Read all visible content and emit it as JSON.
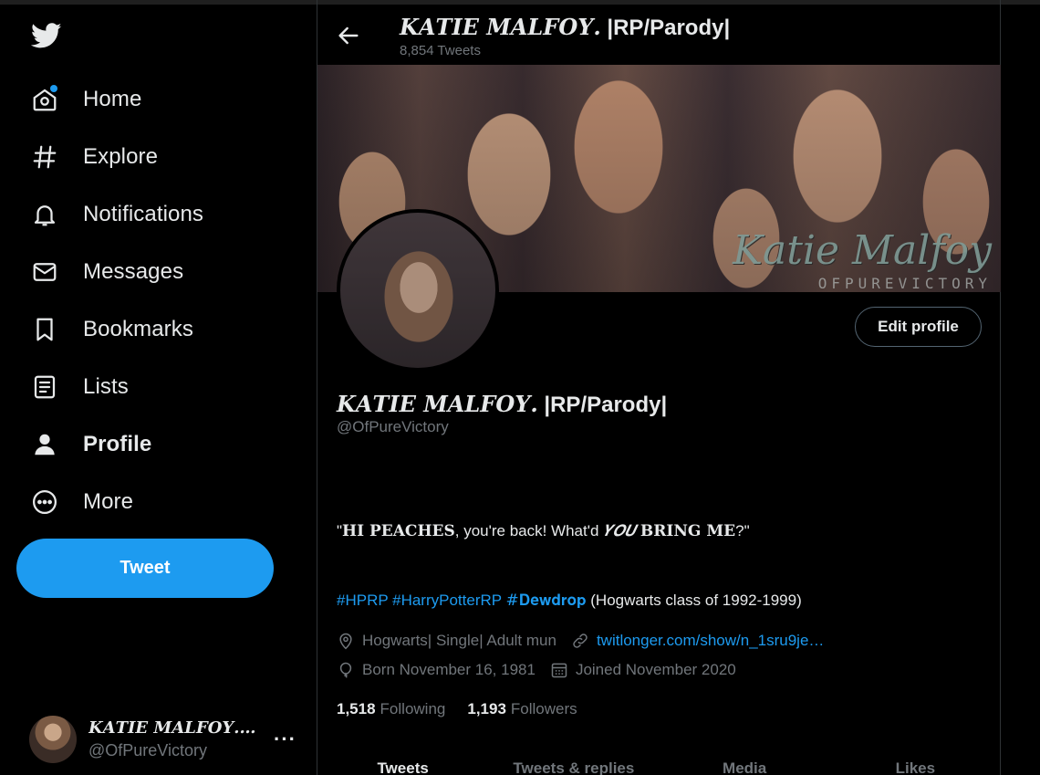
{
  "sidebar": {
    "items": [
      {
        "label": "Home",
        "icon": "home-icon"
      },
      {
        "label": "Explore",
        "icon": "hashtag-icon"
      },
      {
        "label": "Notifications",
        "icon": "bell-icon"
      },
      {
        "label": "Messages",
        "icon": "envelope-icon"
      },
      {
        "label": "Bookmarks",
        "icon": "bookmark-icon"
      },
      {
        "label": "Lists",
        "icon": "list-icon"
      },
      {
        "label": "Profile",
        "icon": "person-icon"
      },
      {
        "label": "More",
        "icon": "more-circle-icon"
      }
    ],
    "tweet_label": "Tweet",
    "account": {
      "name": "𝑲𝑨𝑻𝑰𝑬 𝑴𝑨𝑳𝑭𝑶𝒀. ...",
      "handle": "@OfPureVictory",
      "more": "···"
    }
  },
  "header": {
    "name_styled": "𝑲𝑨𝑻𝑰𝑬 𝑴𝑨𝑳𝑭𝑶𝒀.",
    "name_rest": " |RP/Parody|",
    "tweet_count": "8,854 Tweets"
  },
  "banner": {
    "signature": "Katie Malfoy",
    "subtitle": "OFPUREVICTORY"
  },
  "profile": {
    "edit_label": "Edit profile",
    "name_styled": "𝑲𝑨𝑻𝑰𝑬 𝑴𝑨𝑳𝑭𝑶𝒀.",
    "name_rest": " |RP/Parody|",
    "handle": "@OfPureVictory",
    "bio": {
      "open_quote": "\"",
      "styled1": "𝐇𝐈 𝐏𝐄𝐀𝐂𝐇𝐄𝐒",
      "middle": ", you're back! What'd ",
      "styled2": "𝒀𝑶𝑼",
      "space": " ",
      "styled3": "𝐁𝐑𝐈𝐍𝐆 𝐌𝐄",
      "end": "?\""
    },
    "tags": [
      "#HPRP",
      "#HarryPotterRP",
      "#𝐃𝐞𝐰𝐝𝐫𝐨𝐩"
    ],
    "tags_after": "(Hogwarts class of 1992-1999)",
    "location": "Hogwarts| Single| Adult mun",
    "url": "twitlonger.com/show/n_1sru9je…",
    "born": "Born November 16, 1981",
    "joined": "Joined November 2020",
    "following_count": "1,518",
    "following_label": "Following",
    "followers_count": "1,193",
    "followers_label": "Followers"
  },
  "tabs": [
    "Tweets",
    "Tweets & replies",
    "Media",
    "Likes"
  ],
  "colors": {
    "accent": "#1d9bf0",
    "background": "#000000",
    "text": "#e7e9ea",
    "muted": "#71767b",
    "border": "#2f3336"
  }
}
